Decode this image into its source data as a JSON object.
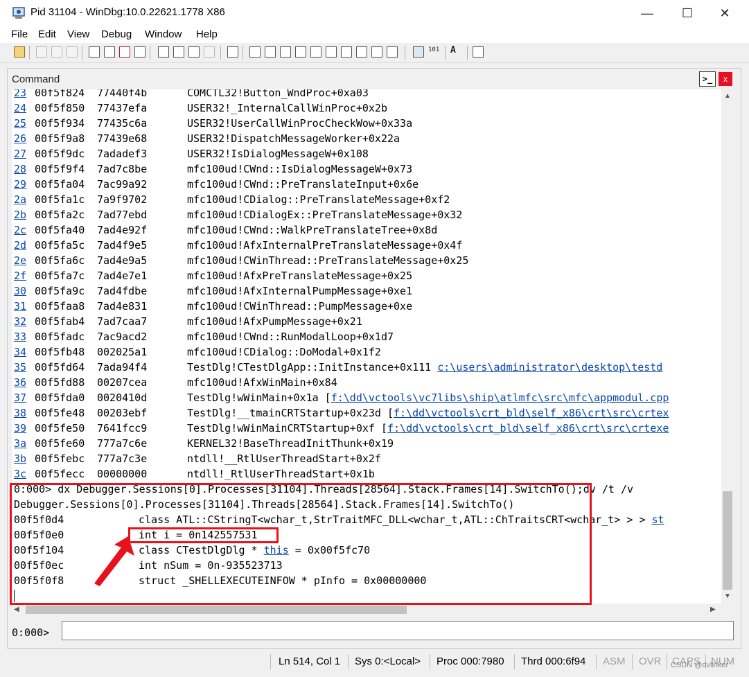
{
  "window": {
    "title": "Pid 31104 - WinDbg:10.0.22621.1778 X86",
    "min_glyph": "—",
    "max_glyph": "☐",
    "close_glyph": "✕"
  },
  "menu": [
    "File",
    "Edit",
    "View",
    "Debug",
    "Window",
    "Help"
  ],
  "toolbar": {
    "font_size_glyph": "A",
    "hex_glyph": "101"
  },
  "command_window": {
    "title": "Command",
    "icon_glyph": ">_",
    "close_glyph": "x",
    "stack_frames": [
      {
        "frame": "23",
        "child_sp": "00f5f824",
        "ret_addr": "77440f4b",
        "call_site": "COMCTL32!Button_WndProc+0xa03"
      },
      {
        "frame": "24",
        "child_sp": "00f5f850",
        "ret_addr": "77437efa",
        "call_site": "USER32!_InternalCallWinProc+0x2b"
      },
      {
        "frame": "25",
        "child_sp": "00f5f934",
        "ret_addr": "77435c6a",
        "call_site": "USER32!UserCallWinProcCheckWow+0x33a"
      },
      {
        "frame": "26",
        "child_sp": "00f5f9a8",
        "ret_addr": "77439e68",
        "call_site": "USER32!DispatchMessageWorker+0x22a"
      },
      {
        "frame": "27",
        "child_sp": "00f5f9dc",
        "ret_addr": "7adadef3",
        "call_site": "USER32!IsDialogMessageW+0x108"
      },
      {
        "frame": "28",
        "child_sp": "00f5f9f4",
        "ret_addr": "7ad7c8be",
        "call_site": "mfc100ud!CWnd::IsDialogMessageW+0x73"
      },
      {
        "frame": "29",
        "child_sp": "00f5fa04",
        "ret_addr": "7ac99a92",
        "call_site": "mfc100ud!CWnd::PreTranslateInput+0x6e"
      },
      {
        "frame": "2a",
        "child_sp": "00f5fa1c",
        "ret_addr": "7a9f9702",
        "call_site": "mfc100ud!CDialog::PreTranslateMessage+0xf2"
      },
      {
        "frame": "2b",
        "child_sp": "00f5fa2c",
        "ret_addr": "7ad77ebd",
        "call_site": "mfc100ud!CDialogEx::PreTranslateMessage+0x32"
      },
      {
        "frame": "2c",
        "child_sp": "00f5fa40",
        "ret_addr": "7ad4e92f",
        "call_site": "mfc100ud!CWnd::WalkPreTranslateTree+0x8d"
      },
      {
        "frame": "2d",
        "child_sp": "00f5fa5c",
        "ret_addr": "7ad4f9e5",
        "call_site": "mfc100ud!AfxInternalPreTranslateMessage+0x4f"
      },
      {
        "frame": "2e",
        "child_sp": "00f5fa6c",
        "ret_addr": "7ad4e9a5",
        "call_site": "mfc100ud!CWinThread::PreTranslateMessage+0x25"
      },
      {
        "frame": "2f",
        "child_sp": "00f5fa7c",
        "ret_addr": "7ad4e7e1",
        "call_site": "mfc100ud!AfxPreTranslateMessage+0x25"
      },
      {
        "frame": "30",
        "child_sp": "00f5fa9c",
        "ret_addr": "7ad4fdbe",
        "call_site": "mfc100ud!AfxInternalPumpMessage+0xe1"
      },
      {
        "frame": "31",
        "child_sp": "00f5faa8",
        "ret_addr": "7ad4e831",
        "call_site": "mfc100ud!CWinThread::PumpMessage+0xe"
      },
      {
        "frame": "32",
        "child_sp": "00f5fab4",
        "ret_addr": "7ad7caa7",
        "call_site": "mfc100ud!AfxPumpMessage+0x21"
      },
      {
        "frame": "33",
        "child_sp": "00f5fadc",
        "ret_addr": "7ac9acd2",
        "call_site": "mfc100ud!CWnd::RunModalLoop+0x1d7"
      },
      {
        "frame": "34",
        "child_sp": "00f5fb48",
        "ret_addr": "002025a1",
        "call_site": "mfc100ud!CDialog::DoModal+0x1f2"
      },
      {
        "frame": "35",
        "child_sp": "00f5fd64",
        "ret_addr": "7ada94f4",
        "call_site": "TestDlg!CTestDlgApp::InitInstance+0x111 ",
        "source_link": "c:\\users\\administrator\\desktop\\testd"
      },
      {
        "frame": "36",
        "child_sp": "00f5fd88",
        "ret_addr": "00207cea",
        "call_site": "mfc100ud!AfxWinMain+0x84"
      },
      {
        "frame": "37",
        "child_sp": "00f5fda0",
        "ret_addr": "0020410d",
        "call_site": "TestDlg!wWinMain+0x1a [",
        "source_link": "f:\\dd\\vctools\\vc7libs\\ship\\atlmfc\\src\\mfc\\appmodul.cpp"
      },
      {
        "frame": "38",
        "child_sp": "00f5fe48",
        "ret_addr": "00203ebf",
        "call_site": "TestDlg!__tmainCRTStartup+0x23d [",
        "source_link": "f:\\dd\\vctools\\crt_bld\\self_x86\\crt\\src\\crtex"
      },
      {
        "frame": "39",
        "child_sp": "00f5fe50",
        "ret_addr": "7641fcc9",
        "call_site": "TestDlg!wWinMainCRTStartup+0xf [",
        "source_link": "f:\\dd\\vctools\\crt_bld\\self_x86\\crt\\src\\crtexe"
      },
      {
        "frame": "3a",
        "child_sp": "00f5fe60",
        "ret_addr": "777a7c6e",
        "call_site": "KERNEL32!BaseThreadInitThunk+0x19"
      },
      {
        "frame": "3b",
        "child_sp": "00f5febc",
        "ret_addr": "777a7c3e",
        "call_site": "ntdll!__RtlUserThreadStart+0x2f"
      },
      {
        "frame": "3c",
        "child_sp": "00f5fecc",
        "ret_addr": "00000000",
        "call_site": "ntdll!_RtlUserThreadStart+0x1b"
      }
    ],
    "command_echo": "0:000> dx Debugger.Sessions[0].Processes[31104].Threads[28564].Stack.Frames[14].SwitchTo();dv /t /v",
    "command_result": "Debugger.Sessions[0].Processes[31104].Threads[28564].Stack.Frames[14].SwitchTo()",
    "locals": [
      {
        "addr": "00f5f0d4",
        "text": "class ATL::CStringT<wchar_t,StrTraitMFC_DLL<wchar_t,ATL::ChTraitsCRT<wchar_t> > > ",
        "link": "st"
      },
      {
        "addr": "00f5f0e0",
        "text": "int i = 0n142557531"
      },
      {
        "addr": "00f5f104",
        "text": "class CTestDlgDlg * ",
        "link": "this",
        "suffix": " = 0x00f5fc70"
      },
      {
        "addr": "00f5f0ec",
        "text": "int nSum = 0n-935523713"
      },
      {
        "addr": "00f5f0f8",
        "text": "struct _SHELLEXECUTEINFOW * pInfo = 0x00000000"
      }
    ],
    "input_prompt": "0:000>",
    "input_value": ""
  },
  "status": {
    "position": "Ln 514, Col 1",
    "sys": "Sys 0:<Local>",
    "proc": "Proc 000:7980",
    "thrd": "Thrd 000:6f94",
    "asm": "ASM",
    "ovr": "OVR",
    "caps": "CAPS",
    "num": "NUM"
  },
  "watermark": "CSDN @dvlinker",
  "colors": {
    "link": "#0645ad",
    "annotation": "#e8121c"
  }
}
